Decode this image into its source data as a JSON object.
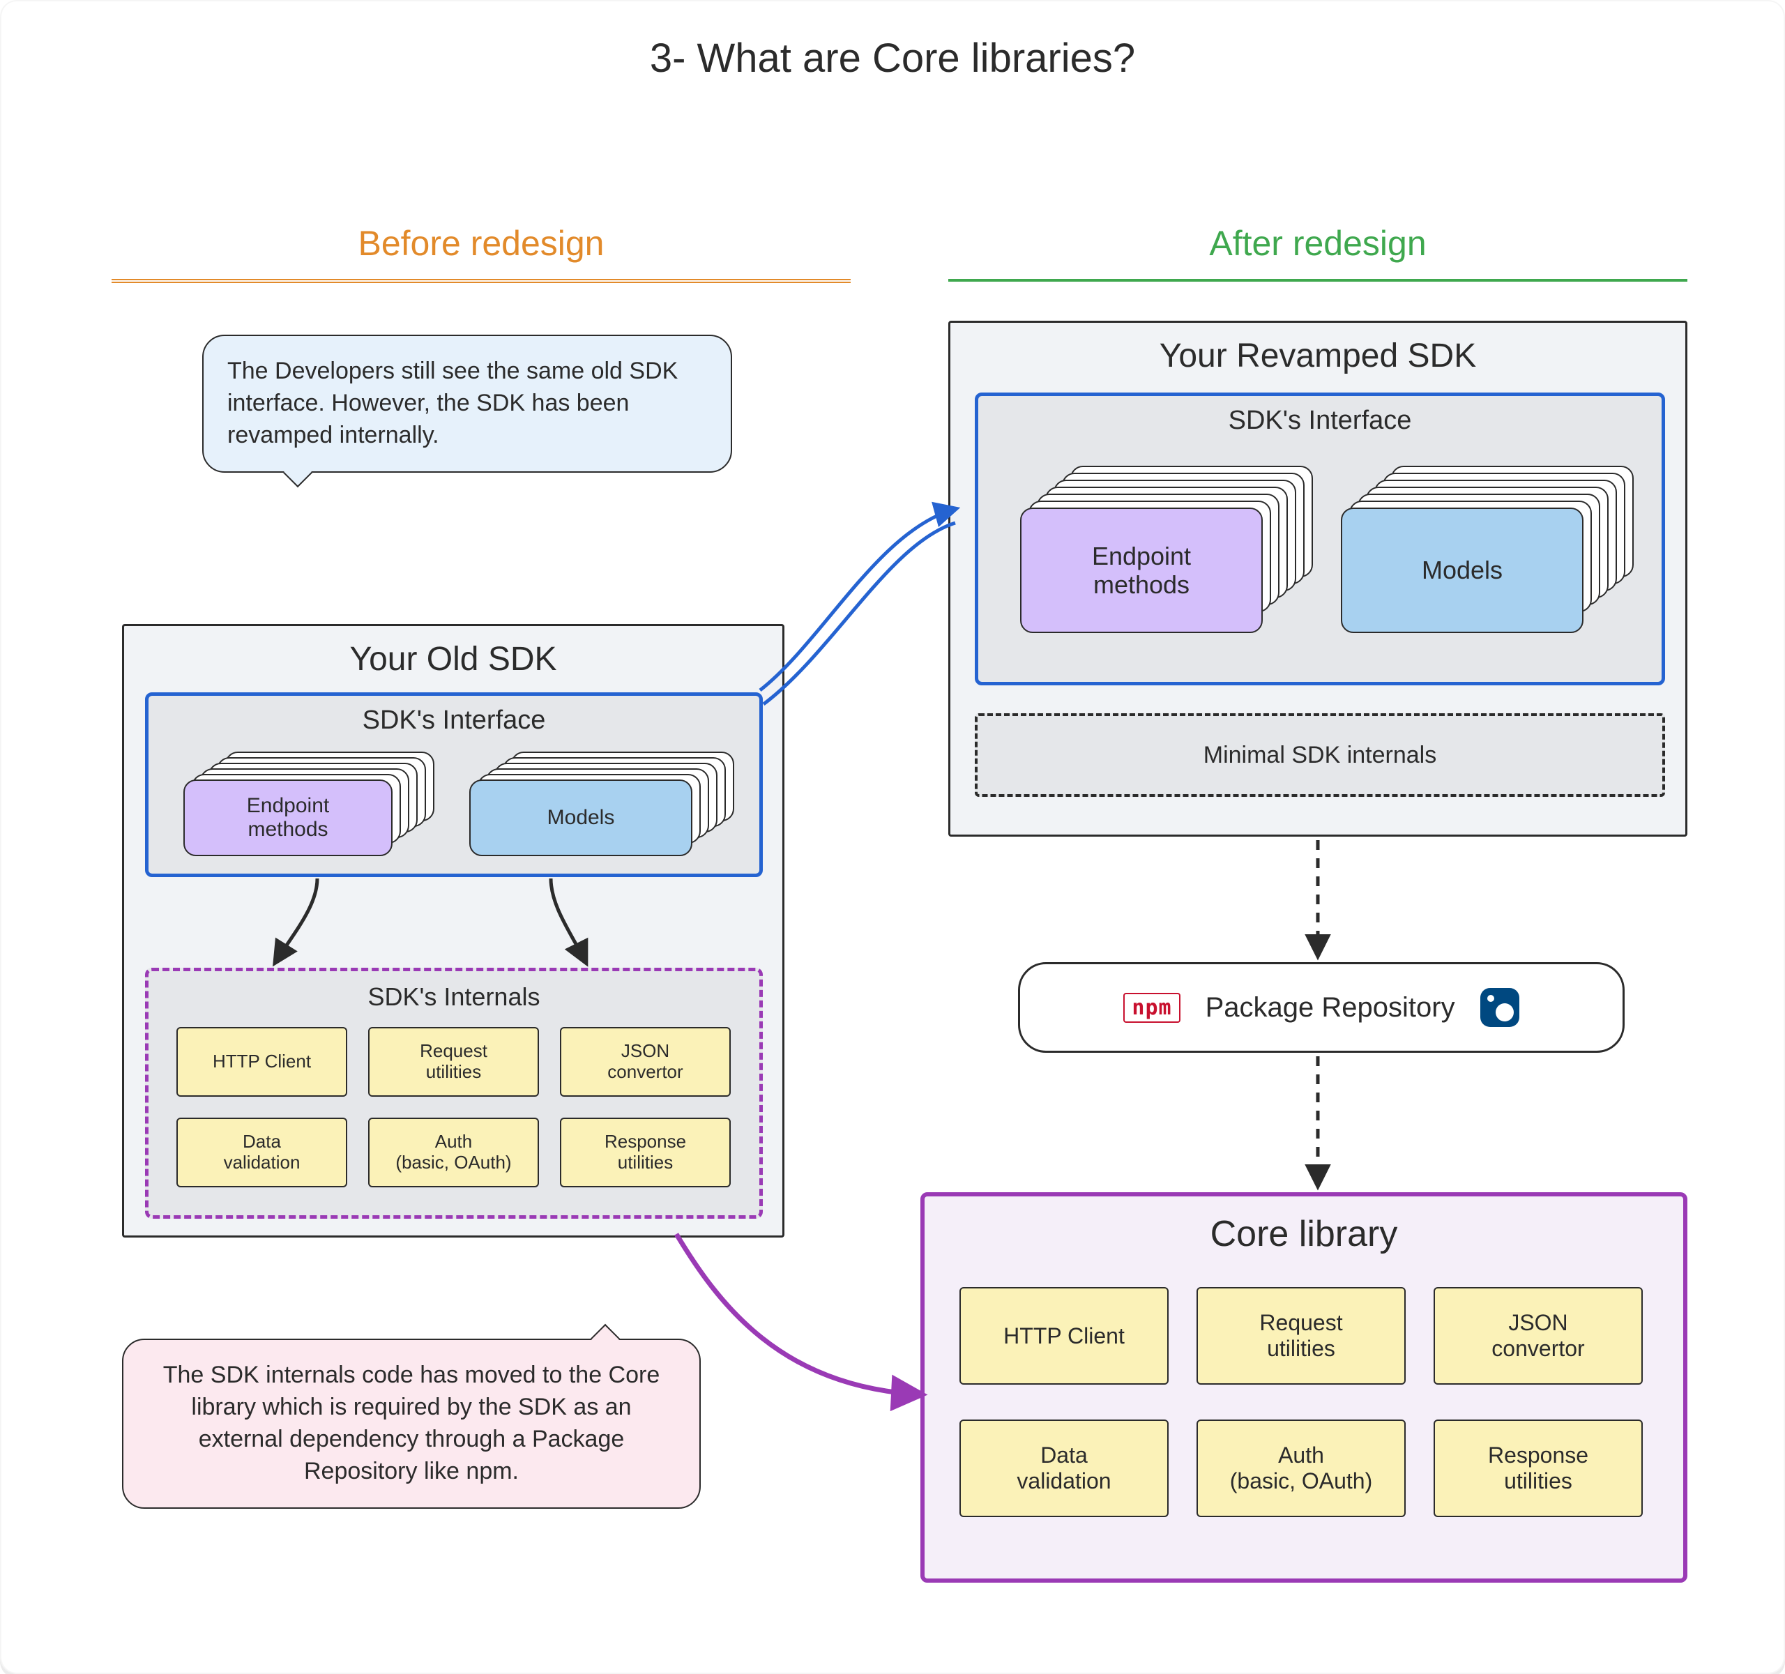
{
  "title": "3- What are Core libraries?",
  "sections": {
    "before": "Before redesign",
    "after": "After redesign"
  },
  "callouts": {
    "top": "The Developers still see the same old SDK interface. However, the SDK has been revamped internally.",
    "bottom": "The SDK internals code has moved to the Core library which is required by the SDK as an external dependency through a Package Repository like npm."
  },
  "old_sdk": {
    "title": "Your Old SDK",
    "interface": {
      "title": "SDK's Interface",
      "cards": {
        "endpoint": "Endpoint\nmethods",
        "models": "Models"
      }
    },
    "internals": {
      "title": "SDK's Internals",
      "items": [
        "HTTP Client",
        "Request\nutilities",
        "JSON\nconvertor",
        "Data\nvalidation",
        "Auth\n(basic, OAuth)",
        "Response\nutilities"
      ]
    }
  },
  "new_sdk": {
    "title": "Your Revamped SDK",
    "interface": {
      "title": "SDK's Interface",
      "cards": {
        "endpoint": "Endpoint\nmethods",
        "models": "Models"
      }
    },
    "minimal": "Minimal SDK internals"
  },
  "package_repo": {
    "label": "Package Repository",
    "npm": "npm"
  },
  "core_library": {
    "title": "Core library",
    "items": [
      "HTTP Client",
      "Request\nutilities",
      "JSON\nconvertor",
      "Data\nvalidation",
      "Auth\n(basic, OAuth)",
      "Response\nutilities"
    ]
  }
}
